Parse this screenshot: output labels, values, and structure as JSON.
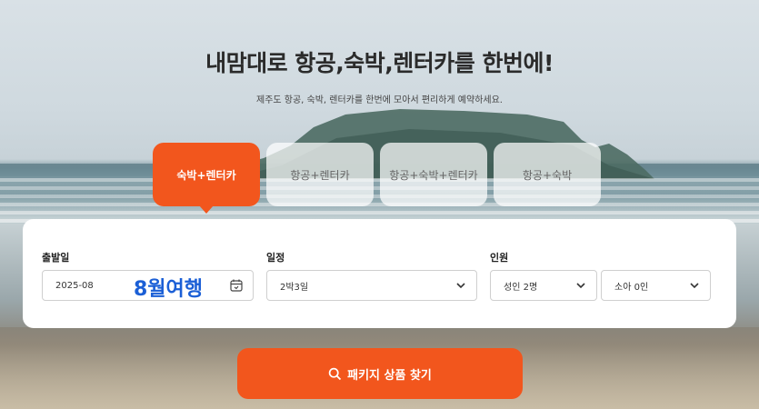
{
  "hero": {
    "title": "내맘대로 항공,숙박,렌터카를 한번에!",
    "subtitle": "제주도 항공, 숙박, 렌터카를 한번에 모아서 편리하게 예약하세요."
  },
  "tabs": [
    {
      "label": "숙박+렌터카",
      "active": true
    },
    {
      "label": "항공+렌터카",
      "active": false
    },
    {
      "label": "항공+숙박+렌터카",
      "active": false
    },
    {
      "label": "항공+숙박",
      "active": false
    }
  ],
  "form": {
    "departure": {
      "label": "출발일",
      "value": "2025-08",
      "overlay": "8월여행",
      "icon": "calendar-icon"
    },
    "schedule": {
      "label": "일정",
      "value": "2박3일",
      "icon": "chevron-down-icon"
    },
    "people": {
      "label": "인원",
      "adults": "성인 2명",
      "children": "소아 0인"
    }
  },
  "search": {
    "label": "패키지 상품 찾기",
    "icon": "search-icon"
  },
  "colors": {
    "accent": "#f2561d",
    "overlay_text": "#1b5fd6"
  }
}
